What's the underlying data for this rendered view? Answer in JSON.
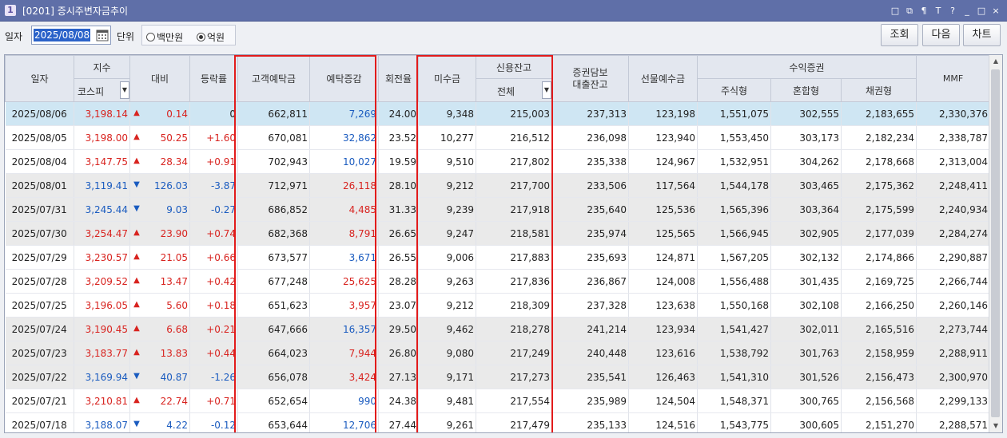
{
  "window": {
    "number": "1",
    "title": "[0201] 증시주변자금추이",
    "controls": [
      "□",
      "⧉",
      "¶",
      "T",
      "?",
      "_",
      "□",
      "×"
    ]
  },
  "toolbar": {
    "date_label": "일자",
    "date_value": "2025/08/08",
    "unit_label": "단위",
    "unit_options": [
      "백만원",
      "억원"
    ],
    "unit_selected": "억원",
    "buttons": {
      "search": "조회",
      "next": "다음",
      "chart": "차트"
    }
  },
  "columns": {
    "date": "일자",
    "index": "지수",
    "index_select": "코스피",
    "change": "대비",
    "rate": "등락률",
    "deposit": "고객예탁금",
    "deposit_change": "예탁증감",
    "turnover": "회전율",
    "receivable": "미수금",
    "credit": "신용잔고",
    "credit_select": "전체",
    "loan": "증권담보\n대출잔고",
    "futures": "선물예수금",
    "fund": "수익증권",
    "stock": "주식형",
    "mixed": "혼합형",
    "bond": "채권형",
    "mmf": "MMF"
  },
  "rows": [
    {
      "date": "2025/08/06",
      "index": "3,198.14",
      "dir": "up",
      "change": "0.14",
      "rate": "0",
      "deposit": "662,811",
      "dchg": "7,269",
      "dchg_dir": "up",
      "turnover": "24.00",
      "receivable": "9,348",
      "credit": "215,003",
      "loan": "237,313",
      "futures": "123,198",
      "stock": "1,551,075",
      "mixed": "302,555",
      "bond": "2,183,655",
      "mmf": "2,330,376"
    },
    {
      "date": "2025/08/05",
      "index": "3,198.00",
      "dir": "up",
      "change": "50.25",
      "rate": "+1.60",
      "deposit": "670,081",
      "dchg": "32,862",
      "dchg_dir": "up",
      "turnover": "23.52",
      "receivable": "10,277",
      "credit": "216,512",
      "loan": "236,098",
      "futures": "123,940",
      "stock": "1,553,450",
      "mixed": "303,173",
      "bond": "2,182,234",
      "mmf": "2,338,787"
    },
    {
      "date": "2025/08/04",
      "index": "3,147.75",
      "dir": "up",
      "change": "28.34",
      "rate": "+0.91",
      "deposit": "702,943",
      "dchg": "10,027",
      "dchg_dir": "up",
      "turnover": "19.59",
      "receivable": "9,510",
      "credit": "217,802",
      "loan": "235,338",
      "futures": "124,967",
      "stock": "1,532,951",
      "mixed": "304,262",
      "bond": "2,178,668",
      "mmf": "2,313,004"
    },
    {
      "date": "2025/08/01",
      "index": "3,119.41",
      "dir": "down",
      "change": "126.03",
      "rate": "-3.87",
      "deposit": "712,971",
      "dchg": "26,118",
      "dchg_dir": "down",
      "turnover": "28.10",
      "receivable": "9,212",
      "credit": "217,700",
      "loan": "233,506",
      "futures": "117,564",
      "stock": "1,544,178",
      "mixed": "303,465",
      "bond": "2,175,362",
      "mmf": "2,248,411"
    },
    {
      "date": "2025/07/31",
      "index": "3,245.44",
      "dir": "down",
      "change": "9.03",
      "rate": "-0.27",
      "deposit": "686,852",
      "dchg": "4,485",
      "dchg_dir": "down",
      "turnover": "31.33",
      "receivable": "9,239",
      "credit": "217,918",
      "loan": "235,640",
      "futures": "125,536",
      "stock": "1,565,396",
      "mixed": "303,364",
      "bond": "2,175,599",
      "mmf": "2,240,934"
    },
    {
      "date": "2025/07/30",
      "index": "3,254.47",
      "dir": "up",
      "change": "23.90",
      "rate": "+0.74",
      "deposit": "682,368",
      "dchg": "8,791",
      "dchg_dir": "down",
      "turnover": "26.65",
      "receivable": "9,247",
      "credit": "218,581",
      "loan": "235,974",
      "futures": "125,565",
      "stock": "1,566,945",
      "mixed": "302,905",
      "bond": "2,177,039",
      "mmf": "2,284,274"
    },
    {
      "date": "2025/07/29",
      "index": "3,230.57",
      "dir": "up",
      "change": "21.05",
      "rate": "+0.66",
      "deposit": "673,577",
      "dchg": "3,671",
      "dchg_dir": "up",
      "turnover": "26.55",
      "receivable": "9,006",
      "credit": "217,883",
      "loan": "235,693",
      "futures": "124,871",
      "stock": "1,567,205",
      "mixed": "302,132",
      "bond": "2,174,866",
      "mmf": "2,290,887"
    },
    {
      "date": "2025/07/28",
      "index": "3,209.52",
      "dir": "up",
      "change": "13.47",
      "rate": "+0.42",
      "deposit": "677,248",
      "dchg": "25,625",
      "dchg_dir": "down",
      "turnover": "28.28",
      "receivable": "9,263",
      "credit": "217,836",
      "loan": "236,867",
      "futures": "124,008",
      "stock": "1,556,488",
      "mixed": "301,435",
      "bond": "2,169,725",
      "mmf": "2,266,744"
    },
    {
      "date": "2025/07/25",
      "index": "3,196.05",
      "dir": "up",
      "change": "5.60",
      "rate": "+0.18",
      "deposit": "651,623",
      "dchg": "3,957",
      "dchg_dir": "down",
      "turnover": "23.07",
      "receivable": "9,212",
      "credit": "218,309",
      "loan": "237,328",
      "futures": "123,638",
      "stock": "1,550,168",
      "mixed": "302,108",
      "bond": "2,166,250",
      "mmf": "2,260,146"
    },
    {
      "date": "2025/07/24",
      "index": "3,190.45",
      "dir": "up",
      "change": "6.68",
      "rate": "+0.21",
      "deposit": "647,666",
      "dchg": "16,357",
      "dchg_dir": "up",
      "turnover": "29.50",
      "receivable": "9,462",
      "credit": "218,278",
      "loan": "241,214",
      "futures": "123,934",
      "stock": "1,541,427",
      "mixed": "302,011",
      "bond": "2,165,516",
      "mmf": "2,273,744"
    },
    {
      "date": "2025/07/23",
      "index": "3,183.77",
      "dir": "up",
      "change": "13.83",
      "rate": "+0.44",
      "deposit": "664,023",
      "dchg": "7,944",
      "dchg_dir": "down",
      "turnover": "26.80",
      "receivable": "9,080",
      "credit": "217,249",
      "loan": "240,448",
      "futures": "123,616",
      "stock": "1,538,792",
      "mixed": "301,763",
      "bond": "2,158,959",
      "mmf": "2,288,911"
    },
    {
      "date": "2025/07/22",
      "index": "3,169.94",
      "dir": "down",
      "change": "40.87",
      "rate": "-1.26",
      "deposit": "656,078",
      "dchg": "3,424",
      "dchg_dir": "down",
      "turnover": "27.13",
      "receivable": "9,171",
      "credit": "217,273",
      "loan": "235,541",
      "futures": "126,463",
      "stock": "1,541,310",
      "mixed": "301,526",
      "bond": "2,156,473",
      "mmf": "2,300,970"
    },
    {
      "date": "2025/07/21",
      "index": "3,210.81",
      "dir": "up",
      "change": "22.74",
      "rate": "+0.71",
      "deposit": "652,654",
      "dchg": "990",
      "dchg_dir": "up",
      "turnover": "24.38",
      "receivable": "9,481",
      "credit": "217,554",
      "loan": "235,989",
      "futures": "124,504",
      "stock": "1,548,371",
      "mixed": "300,765",
      "bond": "2,156,568",
      "mmf": "2,299,133"
    },
    {
      "date": "2025/07/18",
      "index": "3,188.07",
      "dir": "down",
      "change": "4.22",
      "rate": "-0.12",
      "deposit": "653,644",
      "dchg": "12,706",
      "dchg_dir": "up",
      "turnover": "27.44",
      "receivable": "9,261",
      "credit": "217,479",
      "loan": "235,133",
      "futures": "124,516",
      "stock": "1,543,775",
      "mixed": "300,605",
      "bond": "2,151,270",
      "mmf": "2,288,571"
    }
  ],
  "row_styles": [
    "sel",
    "",
    "",
    "band",
    "band",
    "band",
    "",
    "",
    "",
    "band",
    "band",
    "band",
    "",
    ""
  ],
  "colors": {
    "up": "#d8231f",
    "down": "#1a5bbf",
    "highlight_box": "#e21b1b",
    "selected_row": "#cfe6f3"
  }
}
